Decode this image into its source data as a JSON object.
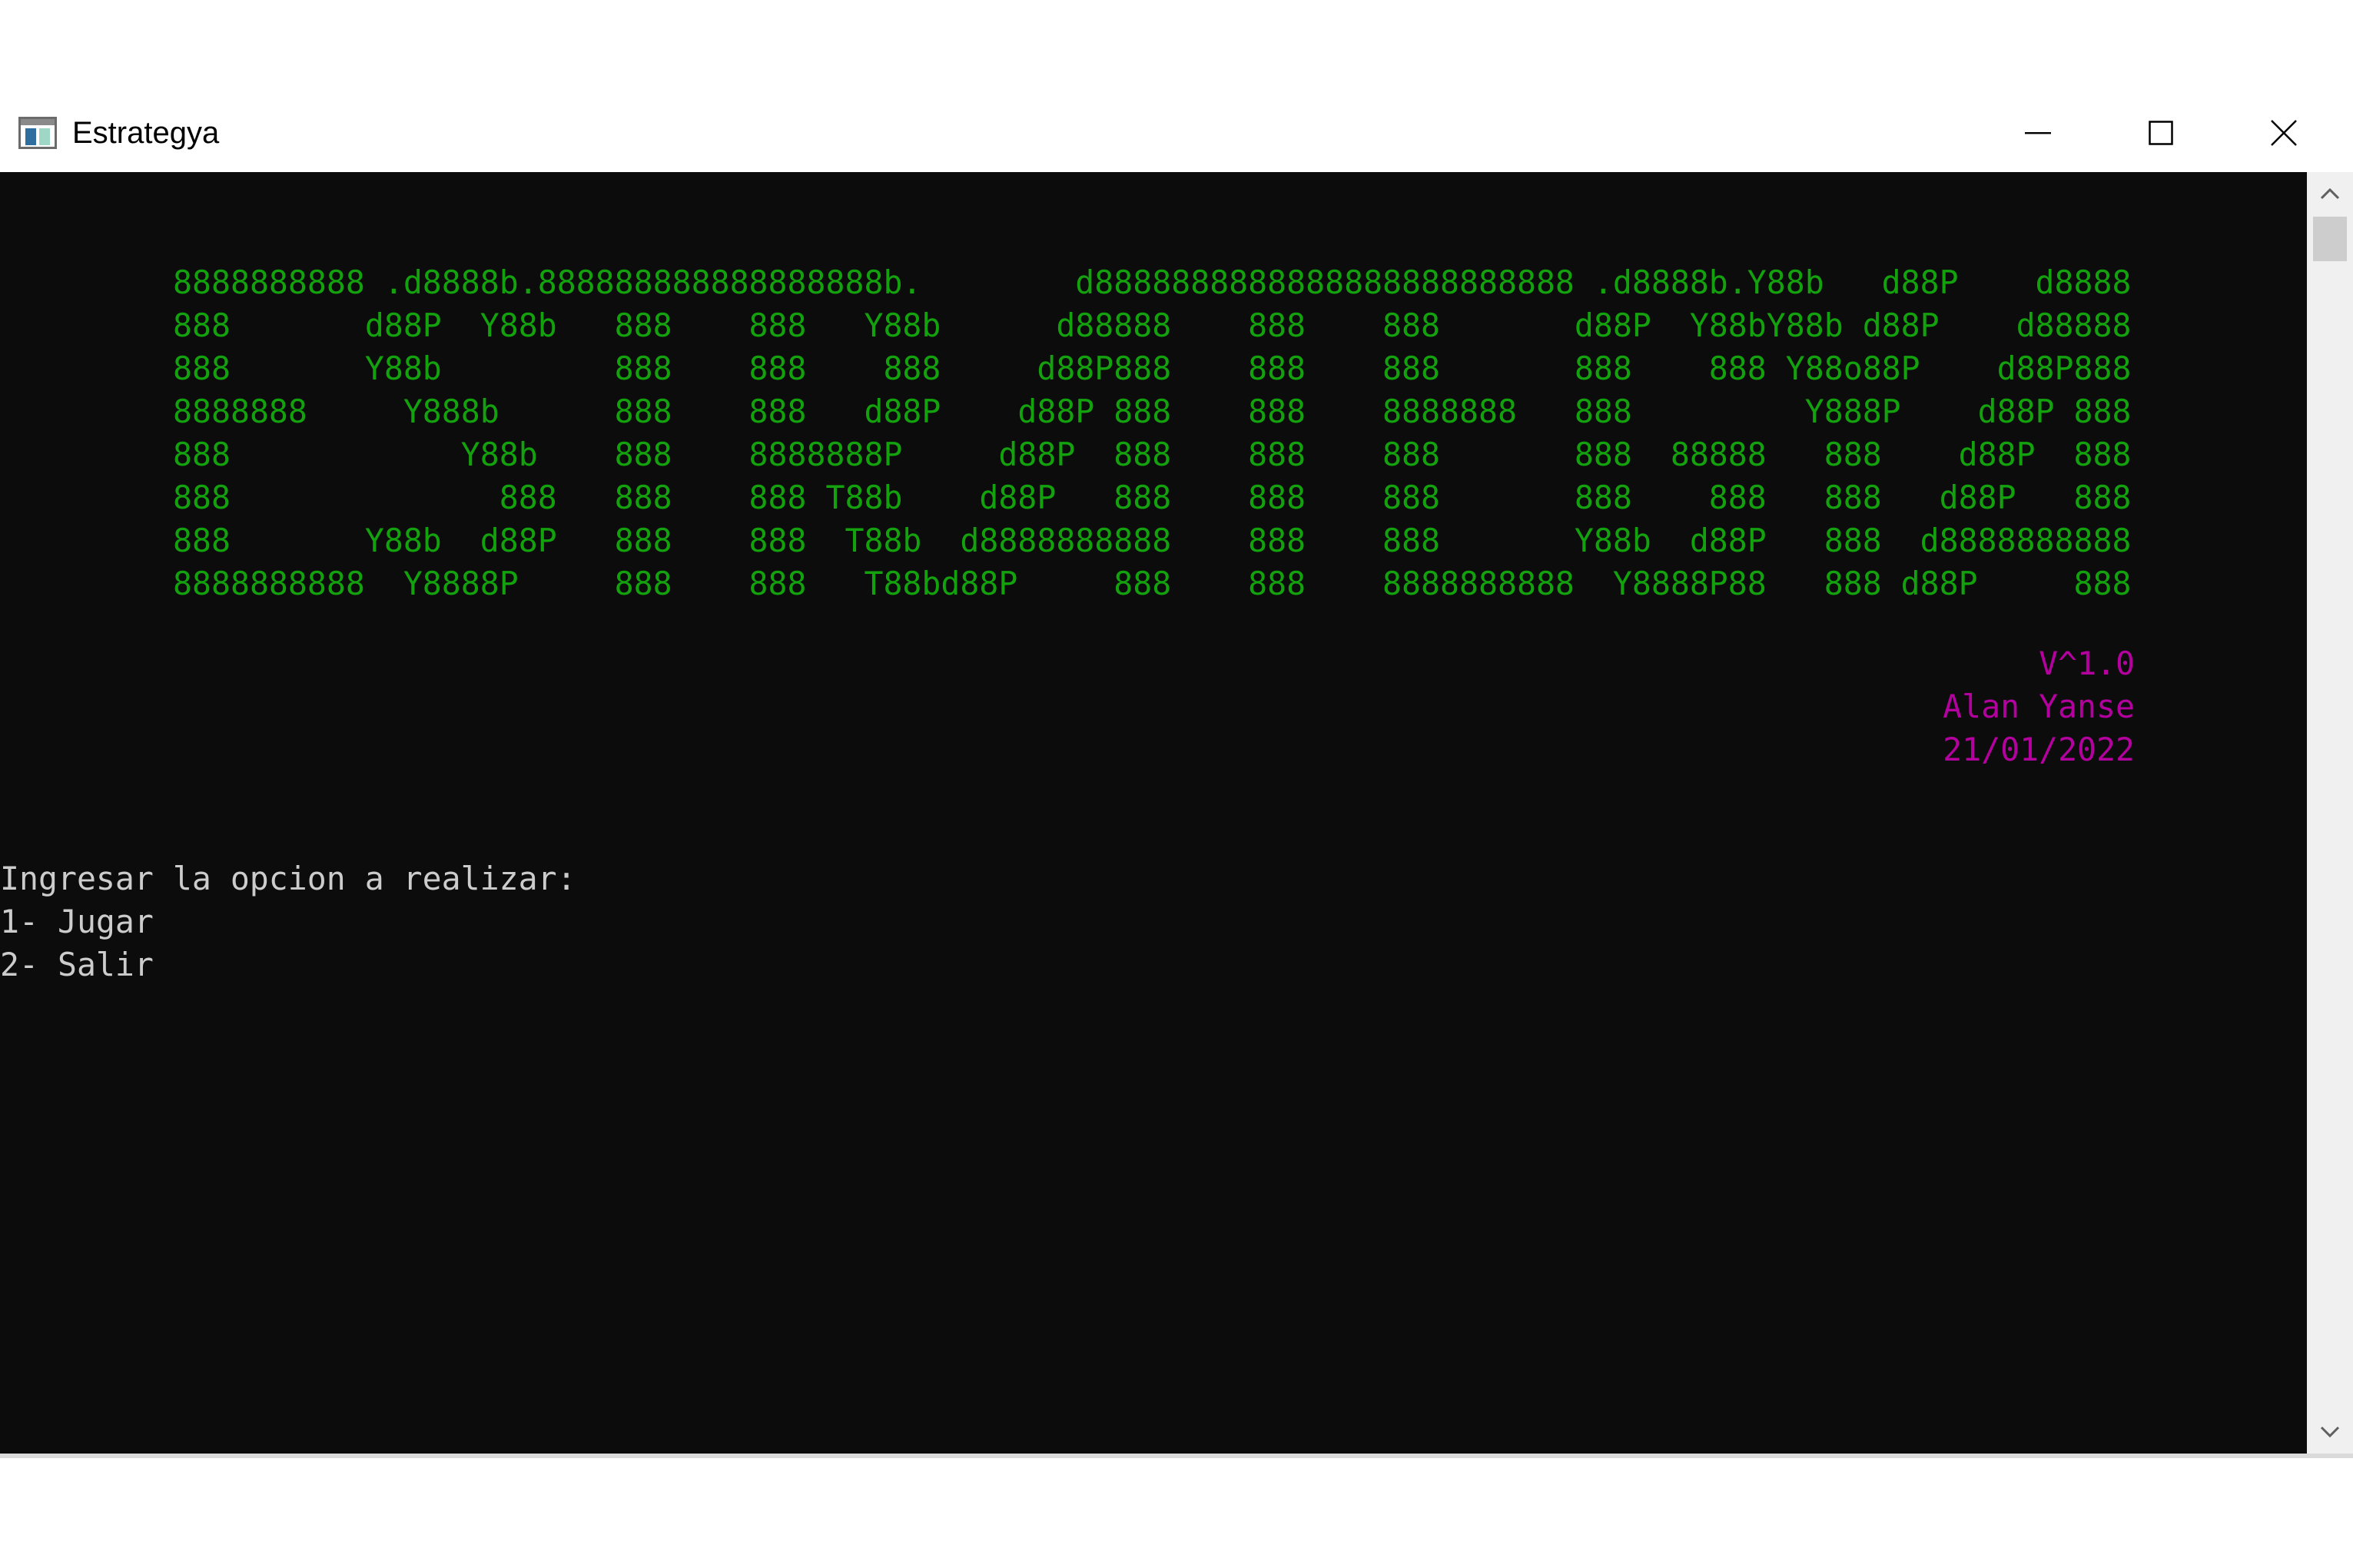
{
  "window": {
    "title": "Estrategya",
    "controls": {
      "minimize_icon": "minimize-icon",
      "maximize_icon": "maximize-icon",
      "close_icon": "close-icon"
    }
  },
  "console": {
    "colors": {
      "background": "#0c0c0c",
      "banner": "#13a10e",
      "credits": "#b4009e",
      "text": "#cccccc"
    },
    "banner": "8888888888 .d8888b.888888888888888888b.        d8888888888888888888888888 .d8888b.Y88b   d88P    d8888\n888       d88P  Y88b   888    888   Y88b      d88888    888    888       d88P  Y88bY88b d88P    d88888\n888       Y88b         888    888    888     d88P888    888    888       888    888 Y88o88P    d88P888\n8888888     Y888b      888    888   d88P    d88P 888    888    8888888   888         Y888P    d88P 888\n888            Y88b    888    8888888P     d88P  888    888    888       888  88888   888    d88P  888\n888              888   888    888 T88b    d88P   888    888    888       888    888   888   d88P   888\n888       Y88b  d88P   888    888  T88b  d8888888888    888    888       Y88b  d88P   888  d8888888888\n8888888888  Y8888P     888    888   T88bd88P     888    888    8888888888  Y8888P88   888 d88P     888",
    "credits": {
      "version": "V^1.0",
      "author": "Alan Yanse",
      "date": "21/01/2022"
    },
    "menu": {
      "prompt": "Ingresar la opcion a realizar:",
      "options": [
        "1- Jugar",
        "2- Salir"
      ]
    }
  },
  "scrollbar": {
    "up_icon": "chevron-up-icon",
    "down_icon": "chevron-down-icon"
  }
}
